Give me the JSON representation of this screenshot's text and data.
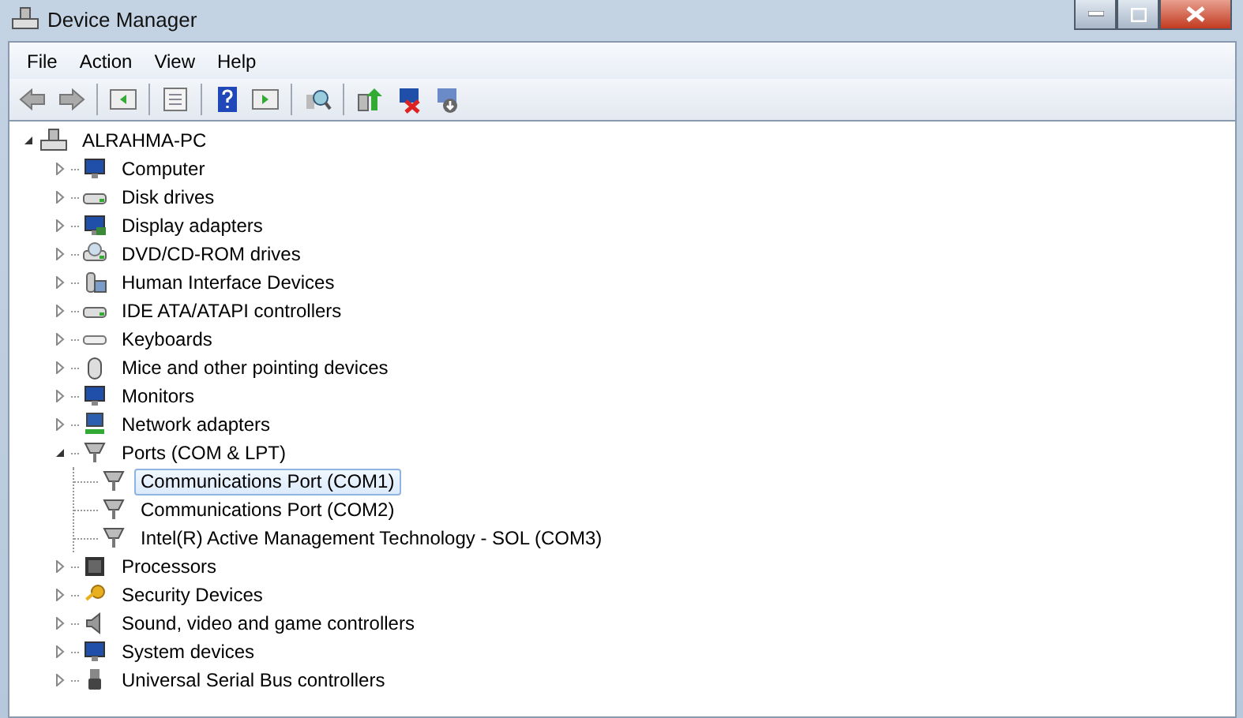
{
  "window": {
    "title": "Device Manager"
  },
  "menu": [
    {
      "label": "File"
    },
    {
      "label": "Action"
    },
    {
      "label": "View"
    },
    {
      "label": "Help"
    }
  ],
  "tree": {
    "label": "ALRAHMA-PC",
    "expanded": true,
    "selected": false,
    "children": [
      {
        "label": "Computer",
        "expanded": false,
        "selected": false
      },
      {
        "label": "Disk drives",
        "expanded": false,
        "selected": false
      },
      {
        "label": "Display adapters",
        "expanded": false,
        "selected": false
      },
      {
        "label": "DVD/CD-ROM drives",
        "expanded": false,
        "selected": false
      },
      {
        "label": "Human Interface Devices",
        "expanded": false,
        "selected": false
      },
      {
        "label": "IDE ATA/ATAPI controllers",
        "expanded": false,
        "selected": false
      },
      {
        "label": "Keyboards",
        "expanded": false,
        "selected": false
      },
      {
        "label": "Mice and other pointing devices",
        "expanded": false,
        "selected": false
      },
      {
        "label": "Monitors",
        "expanded": false,
        "selected": false
      },
      {
        "label": "Network adapters",
        "expanded": false,
        "selected": false
      },
      {
        "label": "Ports (COM & LPT)",
        "expanded": true,
        "selected": false,
        "children": [
          {
            "label": "Communications Port (COM1)",
            "selected": true
          },
          {
            "label": "Communications Port (COM2)",
            "selected": false
          },
          {
            "label": "Intel(R) Active Management Technology - SOL (COM3)",
            "selected": false
          }
        ]
      },
      {
        "label": "Processors",
        "expanded": false,
        "selected": false
      },
      {
        "label": "Security Devices",
        "expanded": false,
        "selected": false
      },
      {
        "label": "Sound, video and game controllers",
        "expanded": false,
        "selected": false
      },
      {
        "label": "System devices",
        "expanded": false,
        "selected": false
      },
      {
        "label": "Universal Serial Bus controllers",
        "expanded": false,
        "selected": false
      }
    ]
  }
}
